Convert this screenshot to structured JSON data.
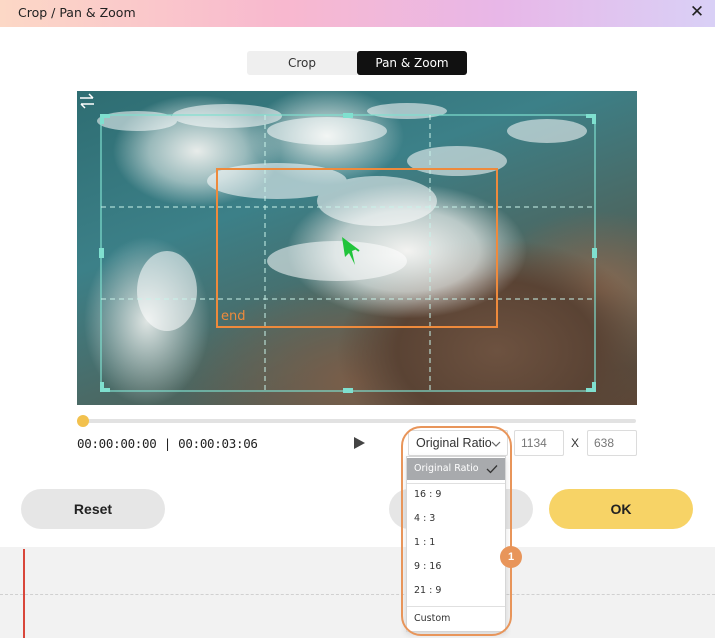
{
  "window": {
    "title": "Crop / Pan & Zoom",
    "close_icon": "close-icon"
  },
  "tabs": [
    {
      "label": "Crop",
      "active": false
    },
    {
      "label": "Pan & Zoom",
      "active": true
    }
  ],
  "preview": {
    "end_label": "end",
    "swap_icon": "swap-arrows-icon"
  },
  "playback": {
    "progress": 0,
    "timecode": "00:00:00:00 | 00:00:03:06",
    "play_icon": "play-icon"
  },
  "ratio": {
    "selected": "Original Ratio",
    "options": [
      "Original Ratio",
      "16 : 9",
      "4 : 3",
      "1 : 1",
      "9 : 16",
      "21 : 9",
      "Custom"
    ],
    "width": "1134",
    "separator": "X",
    "height": "638"
  },
  "buttons": {
    "reset": "Reset",
    "ok": "OK"
  },
  "callout": {
    "badge": "1"
  },
  "colors": {
    "accent_yellow": "#f7d366",
    "crop_frame": "#7fe0cf",
    "zoom_frame": "#ee8a3c",
    "playhead": "#d9463a"
  }
}
